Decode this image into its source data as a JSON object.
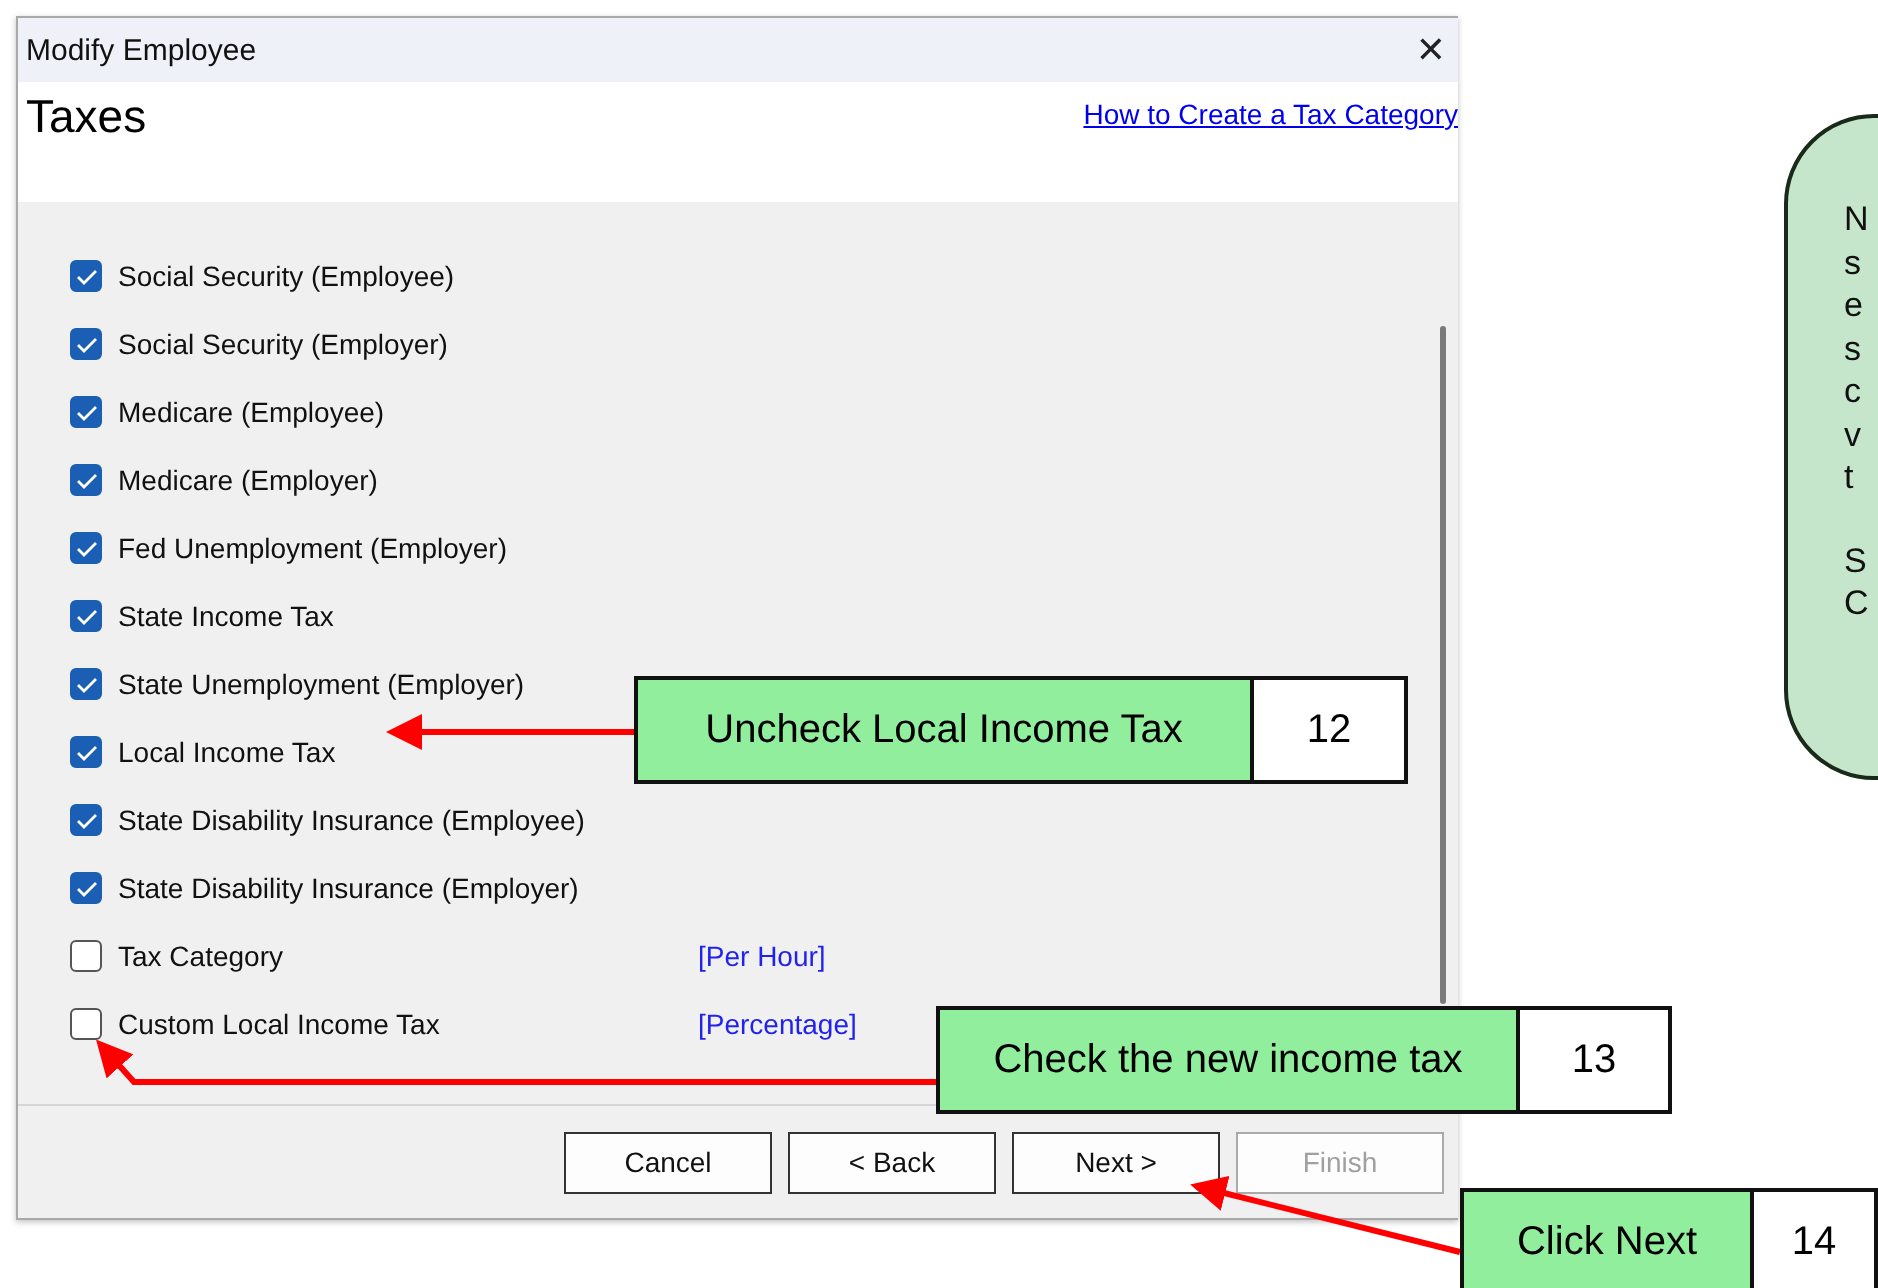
{
  "window": {
    "title": "Modify Employee",
    "close": "✕"
  },
  "page": {
    "heading": "Taxes",
    "help_link": "How to Create a Tax Category"
  },
  "taxes": [
    {
      "label": "Social Security (Employee)",
      "checked": true
    },
    {
      "label": "Social Security (Employer)",
      "checked": true
    },
    {
      "label": "Medicare (Employee)",
      "checked": true
    },
    {
      "label": "Medicare (Employer)",
      "checked": true
    },
    {
      "label": "Fed Unemployment (Employer)",
      "checked": true
    },
    {
      "label": "State Income Tax",
      "checked": true
    },
    {
      "label": "State Unemployment (Employer)",
      "checked": true
    },
    {
      "label": "Local Income Tax",
      "checked": true
    },
    {
      "label": "State Disability Insurance (Employee)",
      "checked": true
    },
    {
      "label": "State Disability Insurance (Employer)",
      "checked": true
    },
    {
      "label": "Tax Category",
      "checked": false,
      "rate": "[Per Hour]"
    },
    {
      "label": "Custom Local Income Tax",
      "checked": false,
      "rate": "[Percentage]"
    }
  ],
  "buttons": [
    {
      "label": "Cancel",
      "disabled": false
    },
    {
      "label": "< Back",
      "disabled": false
    },
    {
      "label": "Next >",
      "disabled": false
    },
    {
      "label": "Finish",
      "disabled": true
    }
  ],
  "callouts": [
    {
      "text": "Uncheck Local Income Tax",
      "step": "12"
    },
    {
      "text": "Check the new income tax",
      "step": "13"
    },
    {
      "text": "Click Next",
      "step": "14"
    }
  ],
  "note": {
    "paragraphs": [
      [
        "N",
        "s",
        "e",
        "s",
        "c",
        "v",
        "t"
      ],
      [
        "S",
        "C"
      ]
    ]
  }
}
